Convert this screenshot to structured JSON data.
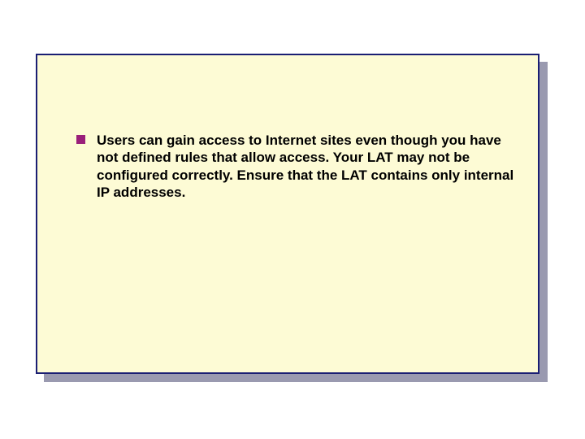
{
  "slide": {
    "bullets": [
      {
        "text": "Users can gain access to Internet sites even though you have not defined rules that allow access. Your LAT may not be configured correctly. Ensure that the LAT contains only internal IP addresses."
      }
    ]
  },
  "colors": {
    "panel_bg": "#fdfbd5",
    "panel_border": "#1a1e73",
    "shadow": "#9a9ab0",
    "bullet": "#9a1f7a"
  }
}
